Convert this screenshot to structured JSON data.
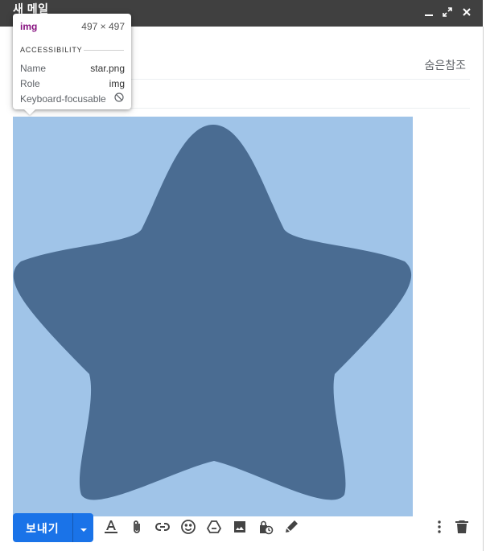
{
  "window": {
    "title": "새 메일",
    "controls": [
      "minimize-icon",
      "expand-icon",
      "close-icon"
    ]
  },
  "recipients": {
    "bcc_label": "숨은참조"
  },
  "inspector_tooltip": {
    "tag": "img",
    "dimensions": "497 × 497",
    "section": "ACCESSIBILITY",
    "rows": [
      {
        "key": "Name",
        "value": "star.png"
      },
      {
        "key": "Role",
        "value": "img"
      },
      {
        "key": "Keyboard-focusable",
        "value": "not-allowed-icon"
      }
    ]
  },
  "body_image": {
    "alt": "star.png",
    "background_color": "#a0c4e8",
    "star_color": "#4a6c92"
  },
  "toolbar": {
    "send_label": "보내기",
    "send_color": "#1a73e8",
    "tools": [
      "text-format-icon",
      "attach-icon",
      "link-icon",
      "emoji-icon",
      "drive-icon",
      "photo-icon",
      "confidential-icon",
      "signature-icon"
    ],
    "right_tools": [
      "more-options-icon",
      "discard-icon"
    ]
  }
}
